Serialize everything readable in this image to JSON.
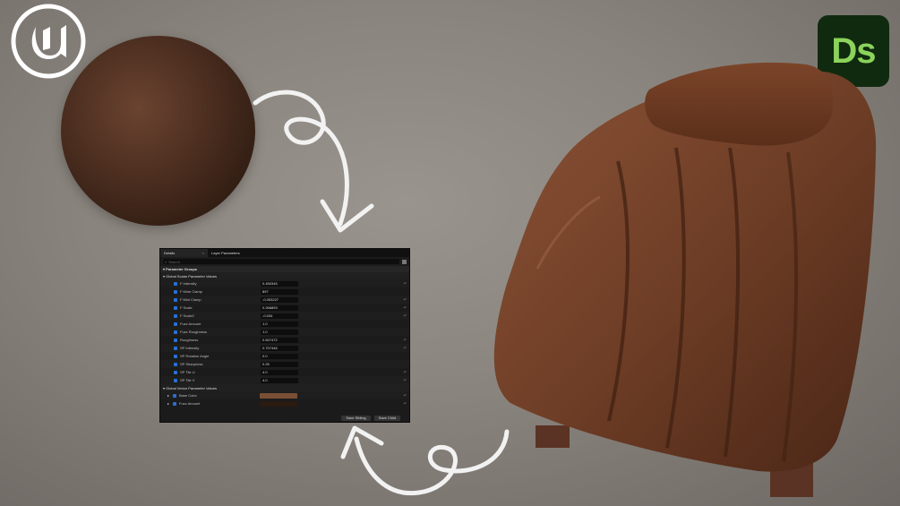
{
  "logos": {
    "unreal": "unreal-engine-logo",
    "substance": {
      "text": "Ds"
    }
  },
  "panel": {
    "tabs": [
      {
        "label": "Details",
        "close": "×"
      },
      {
        "label": "Layer Parameters"
      }
    ],
    "search": {
      "placeholder": "Search"
    },
    "sections": {
      "parameter_groups": "Parameter Groups",
      "scalar": "Global Scalar Parameter Values",
      "vector": "Global Vector Parameter Values"
    },
    "scalar_params": [
      {
        "label": "F Intensity",
        "value": "0.450345",
        "reset": true
      },
      {
        "label": "F Mine Clamp",
        "value": "897",
        "reset": false
      },
      {
        "label": "F Mini Clamp",
        "value": "-0.053227",
        "reset": true
      },
      {
        "label": "F Scale",
        "value": "0.266893",
        "reset": true
      },
      {
        "label": "F Scale2",
        "value": "-0.034",
        "reset": true
      },
      {
        "label": "Fuzz Amount",
        "value": "1.0",
        "reset": false
      },
      {
        "label": "Fuzz Roughness",
        "value": "1.0",
        "reset": false
      },
      {
        "label": "Roughness",
        "value": "0.507472",
        "reset": true
      },
      {
        "label": "SP Intensity",
        "value": "0.707446",
        "reset": true
      },
      {
        "label": "SP Rotation Angle",
        "value": "0.0",
        "reset": false
      },
      {
        "label": "SP Sharpness",
        "value": "0.25",
        "reset": false
      },
      {
        "label": "SP Tile U",
        "value": "4.0",
        "reset": true
      },
      {
        "label": "SP Tile V",
        "value": "4.0",
        "reset": true
      }
    ],
    "vector_params": [
      {
        "label": "Base Color",
        "color": "#7a4f35",
        "reset": true
      },
      {
        "label": "Fuzz Amount",
        "color": "#2a1a10",
        "reset": true
      }
    ],
    "buttons": {
      "save_sibling": "Save Sibling",
      "save_child": "Save Child"
    }
  },
  "colors": {
    "accent": "#2a6fd6",
    "ds_bg": "#0f2a0f",
    "ds_text": "#8bd35a"
  }
}
